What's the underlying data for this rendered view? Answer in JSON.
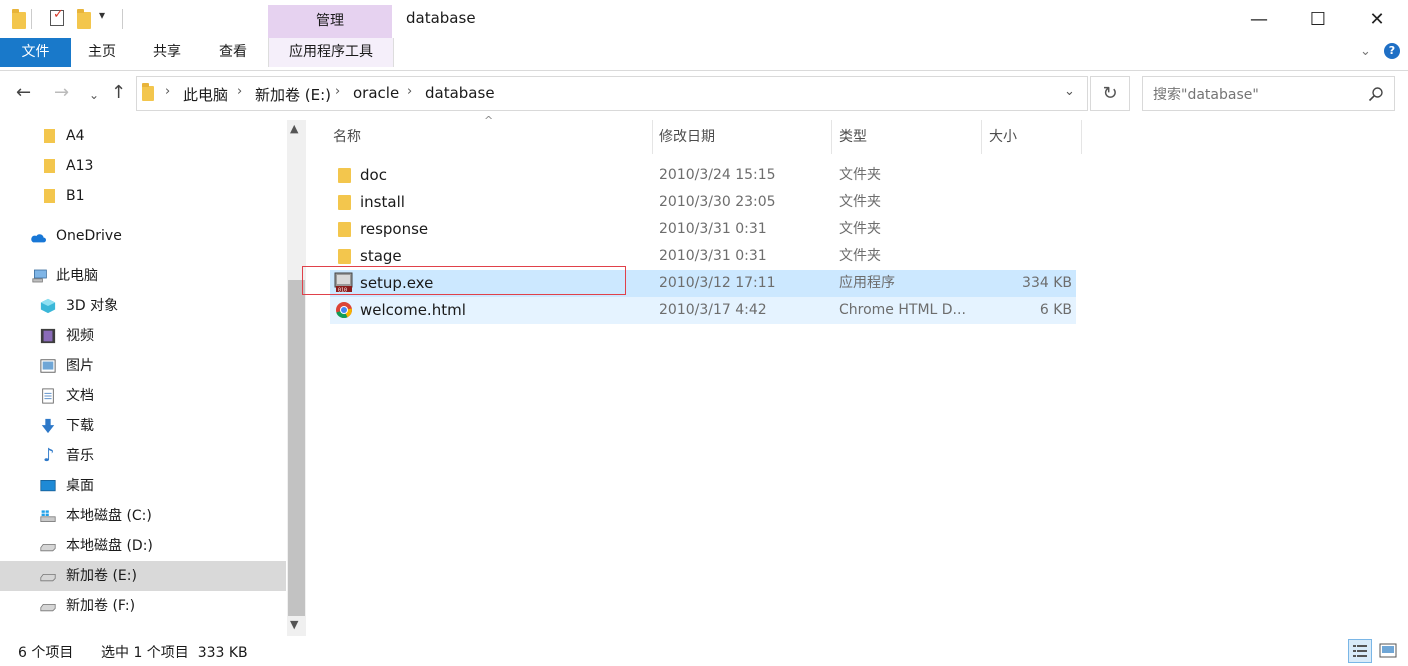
{
  "window": {
    "title": "database",
    "context_tab": "管理",
    "controls": {
      "minimize": "—",
      "maximize": "☐",
      "close": "✕"
    }
  },
  "ribbon": {
    "tabs": [
      {
        "label": "文件",
        "active": true
      },
      {
        "label": "主页"
      },
      {
        "label": "共享"
      },
      {
        "label": "查看"
      },
      {
        "label": "应用程序工具"
      }
    ]
  },
  "address": {
    "breadcrumbs": [
      "此电脑",
      "新加卷 (E:)",
      "oracle",
      "database"
    ]
  },
  "search": {
    "placeholder": "搜索\"database\""
  },
  "sidebar": {
    "items": [
      {
        "label": "A4",
        "icon": "folder-icon"
      },
      {
        "label": "A13",
        "icon": "folder-icon"
      },
      {
        "label": "B1",
        "icon": "folder-icon"
      },
      {
        "label": "OneDrive",
        "icon": "onedrive-icon"
      },
      {
        "label": "此电脑",
        "icon": "this-pc-icon"
      },
      {
        "label": "3D 对象",
        "icon": "3d-objects-icon"
      },
      {
        "label": "视频",
        "icon": "videos-icon"
      },
      {
        "label": "图片",
        "icon": "pictures-icon"
      },
      {
        "label": "文档",
        "icon": "documents-icon"
      },
      {
        "label": "下载",
        "icon": "downloads-icon"
      },
      {
        "label": "音乐",
        "icon": "music-icon"
      },
      {
        "label": "桌面",
        "icon": "desktop-icon"
      },
      {
        "label": "本地磁盘 (C:)",
        "icon": "system-drive-icon"
      },
      {
        "label": "本地磁盘 (D:)",
        "icon": "drive-icon"
      },
      {
        "label": "新加卷 (E:)",
        "icon": "drive-icon",
        "selected": true
      },
      {
        "label": "新加卷 (F:)",
        "icon": "drive-icon"
      }
    ]
  },
  "file_list": {
    "columns": [
      "名称",
      "修改日期",
      "类型",
      "大小"
    ],
    "rows": [
      {
        "name": "doc",
        "date": "2010/3/24 15:15",
        "type": "文件夹",
        "size": "",
        "icon": "folder-icon"
      },
      {
        "name": "install",
        "date": "2010/3/30 23:05",
        "type": "文件夹",
        "size": "",
        "icon": "folder-icon"
      },
      {
        "name": "response",
        "date": "2010/3/31 0:31",
        "type": "文件夹",
        "size": "",
        "icon": "folder-icon"
      },
      {
        "name": "stage",
        "date": "2010/3/31 0:31",
        "type": "文件夹",
        "size": "",
        "icon": "folder-icon"
      },
      {
        "name": "setup.exe",
        "date": "2010/3/12 17:11",
        "type": "应用程序",
        "size": "334 KB",
        "icon": "exe-icon",
        "selected": true
      },
      {
        "name": "welcome.html",
        "date": "2010/3/17 4:42",
        "type": "Chrome HTML D...",
        "size": "6 KB",
        "icon": "chrome-icon"
      }
    ]
  },
  "status": {
    "item_count": "6 个项目",
    "selection": "选中 1 个项目  333 KB"
  }
}
